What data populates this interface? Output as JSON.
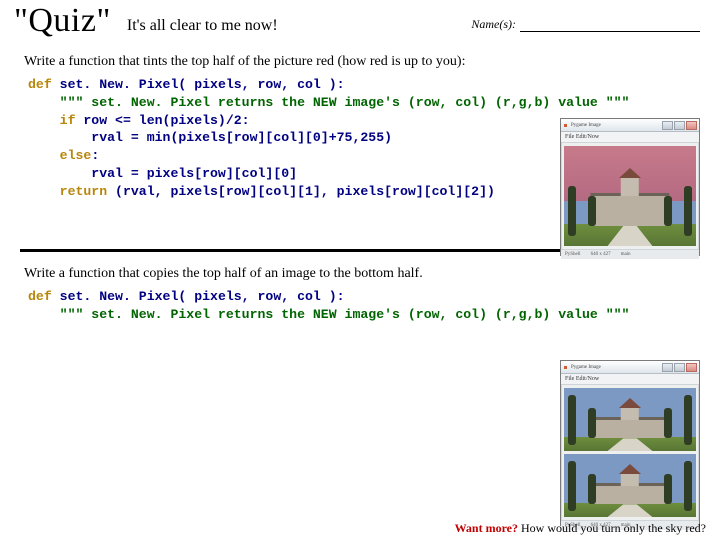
{
  "header": {
    "quiz": "\"Quiz\"",
    "clear": "It's all clear to me now!",
    "names_label": "Name(s):"
  },
  "q1": {
    "prompt": "Write a function that tints the top half of the picture red (how red is up to you):",
    "code": {
      "l1_kw": "def",
      "l1_name": " set. New. Pixel( pixels, row, col ):",
      "l2": "    \"\"\" set. New. Pixel returns the NEW image's (row, col) (r,g,b) value \"\"\"",
      "l3_kw": "    if",
      "l3_rest": " row <= len(pixels)/2:",
      "l4": "        rval = min(pixels[row][col][0]+75,255)",
      "l5_kw": "    else",
      "l5_rest": ":",
      "l6": "        rval = pixels[row][col][0]",
      "l7_kw": "    return",
      "l7_rest": " (rval, pixels[row][col][1], pixels[row][col][2])"
    }
  },
  "q2": {
    "prompt": "Write a function that copies the top half of an image to the bottom half.",
    "code": {
      "l1_kw": "def",
      "l1_name": " set. New. Pixel( pixels, row, col ):",
      "l2": "    \"\"\" set. New. Pixel returns the NEW image's (row, col) (r,g,b) value \"\"\""
    }
  },
  "imgwin": {
    "title": "Pygame Image",
    "menu": "File   Edit/Now",
    "status_l": "PyShell",
    "status_m": "640 x 427",
    "status_r": "main"
  },
  "wantmore": {
    "lead": "Want more?",
    "rest": " How would you turn only the sky red?"
  }
}
